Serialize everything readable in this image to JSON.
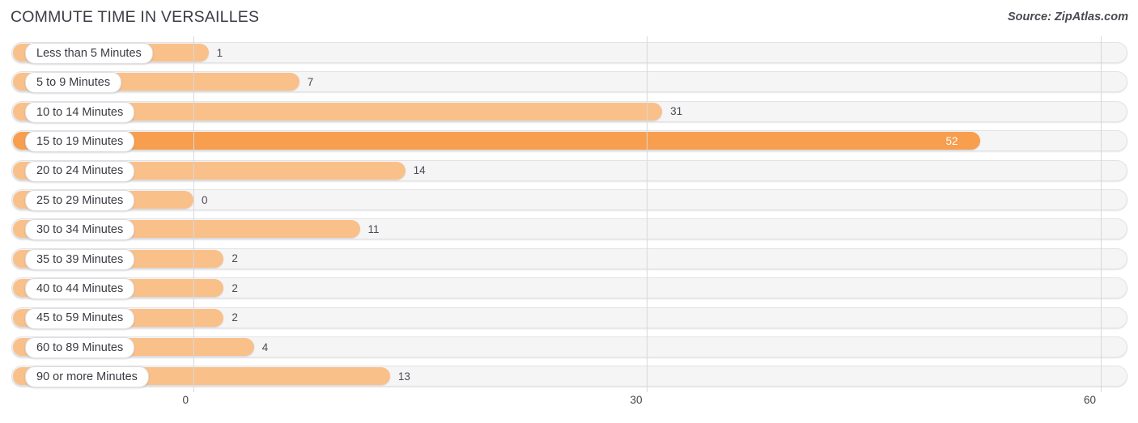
{
  "header": {
    "title": "COMMUTE TIME IN VERSAILLES",
    "source": "Source: ZipAtlas.com"
  },
  "colors": {
    "bar": "#FAC08A",
    "bar_highlight": "#F79E4F",
    "track": "#F5F5F6",
    "track_border": "#E3E3E6",
    "gridline": "#D8D8DC",
    "label_text": "#3A3A42",
    "value_text": "#4A4A55",
    "value_text_inside": "#FFFFFF",
    "title_text": "#3C3C45"
  },
  "chart_data": {
    "type": "bar",
    "orientation": "horizontal",
    "title": "COMMUTE TIME IN VERSAILLES",
    "xlabel": "",
    "ylabel": "",
    "xlim": [
      0,
      60
    ],
    "grid": true,
    "legend": false,
    "xticks": [
      0,
      30,
      60
    ],
    "xtick_labels": [
      "0",
      "30",
      "60"
    ],
    "highlight_category": "15 to 19 Minutes",
    "categories": [
      "Less than 5 Minutes",
      "5 to 9 Minutes",
      "10 to 14 Minutes",
      "15 to 19 Minutes",
      "20 to 24 Minutes",
      "25 to 29 Minutes",
      "30 to 34 Minutes",
      "35 to 39 Minutes",
      "40 to 44 Minutes",
      "45 to 59 Minutes",
      "60 to 89 Minutes",
      "90 or more Minutes"
    ],
    "values": [
      1,
      7,
      31,
      52,
      14,
      0,
      11,
      2,
      2,
      2,
      4,
      13
    ],
    "value_labels": [
      "1",
      "7",
      "31",
      "52",
      "14",
      "0",
      "11",
      "2",
      "2",
      "2",
      "4",
      "13"
    ]
  },
  "rows": [
    {
      "label": "Less than 5 Minutes",
      "value": 1,
      "value_label": "1",
      "highlight": false,
      "value_inside": false
    },
    {
      "label": "5 to 9 Minutes",
      "value": 7,
      "value_label": "7",
      "highlight": false,
      "value_inside": false
    },
    {
      "label": "10 to 14 Minutes",
      "value": 31,
      "value_label": "31",
      "highlight": false,
      "value_inside": false
    },
    {
      "label": "15 to 19 Minutes",
      "value": 52,
      "value_label": "52",
      "highlight": true,
      "value_inside": true
    },
    {
      "label": "20 to 24 Minutes",
      "value": 14,
      "value_label": "14",
      "highlight": false,
      "value_inside": false
    },
    {
      "label": "25 to 29 Minutes",
      "value": 0,
      "value_label": "0",
      "highlight": false,
      "value_inside": false
    },
    {
      "label": "30 to 34 Minutes",
      "value": 11,
      "value_label": "11",
      "highlight": false,
      "value_inside": false
    },
    {
      "label": "35 to 39 Minutes",
      "value": 2,
      "value_label": "2",
      "highlight": false,
      "value_inside": false
    },
    {
      "label": "40 to 44 Minutes",
      "value": 2,
      "value_label": "2",
      "highlight": false,
      "value_inside": false
    },
    {
      "label": "45 to 59 Minutes",
      "value": 2,
      "value_label": "2",
      "highlight": false,
      "value_inside": false
    },
    {
      "label": "60 to 89 Minutes",
      "value": 4,
      "value_label": "4",
      "highlight": false,
      "value_inside": false
    },
    {
      "label": "90 or more Minutes",
      "value": 13,
      "value_label": "13",
      "highlight": false,
      "value_inside": false
    }
  ],
  "axis": {
    "ticks": [
      {
        "label": "0",
        "value": 0
      },
      {
        "label": "30",
        "value": 30
      },
      {
        "label": "60",
        "value": 60
      }
    ]
  }
}
